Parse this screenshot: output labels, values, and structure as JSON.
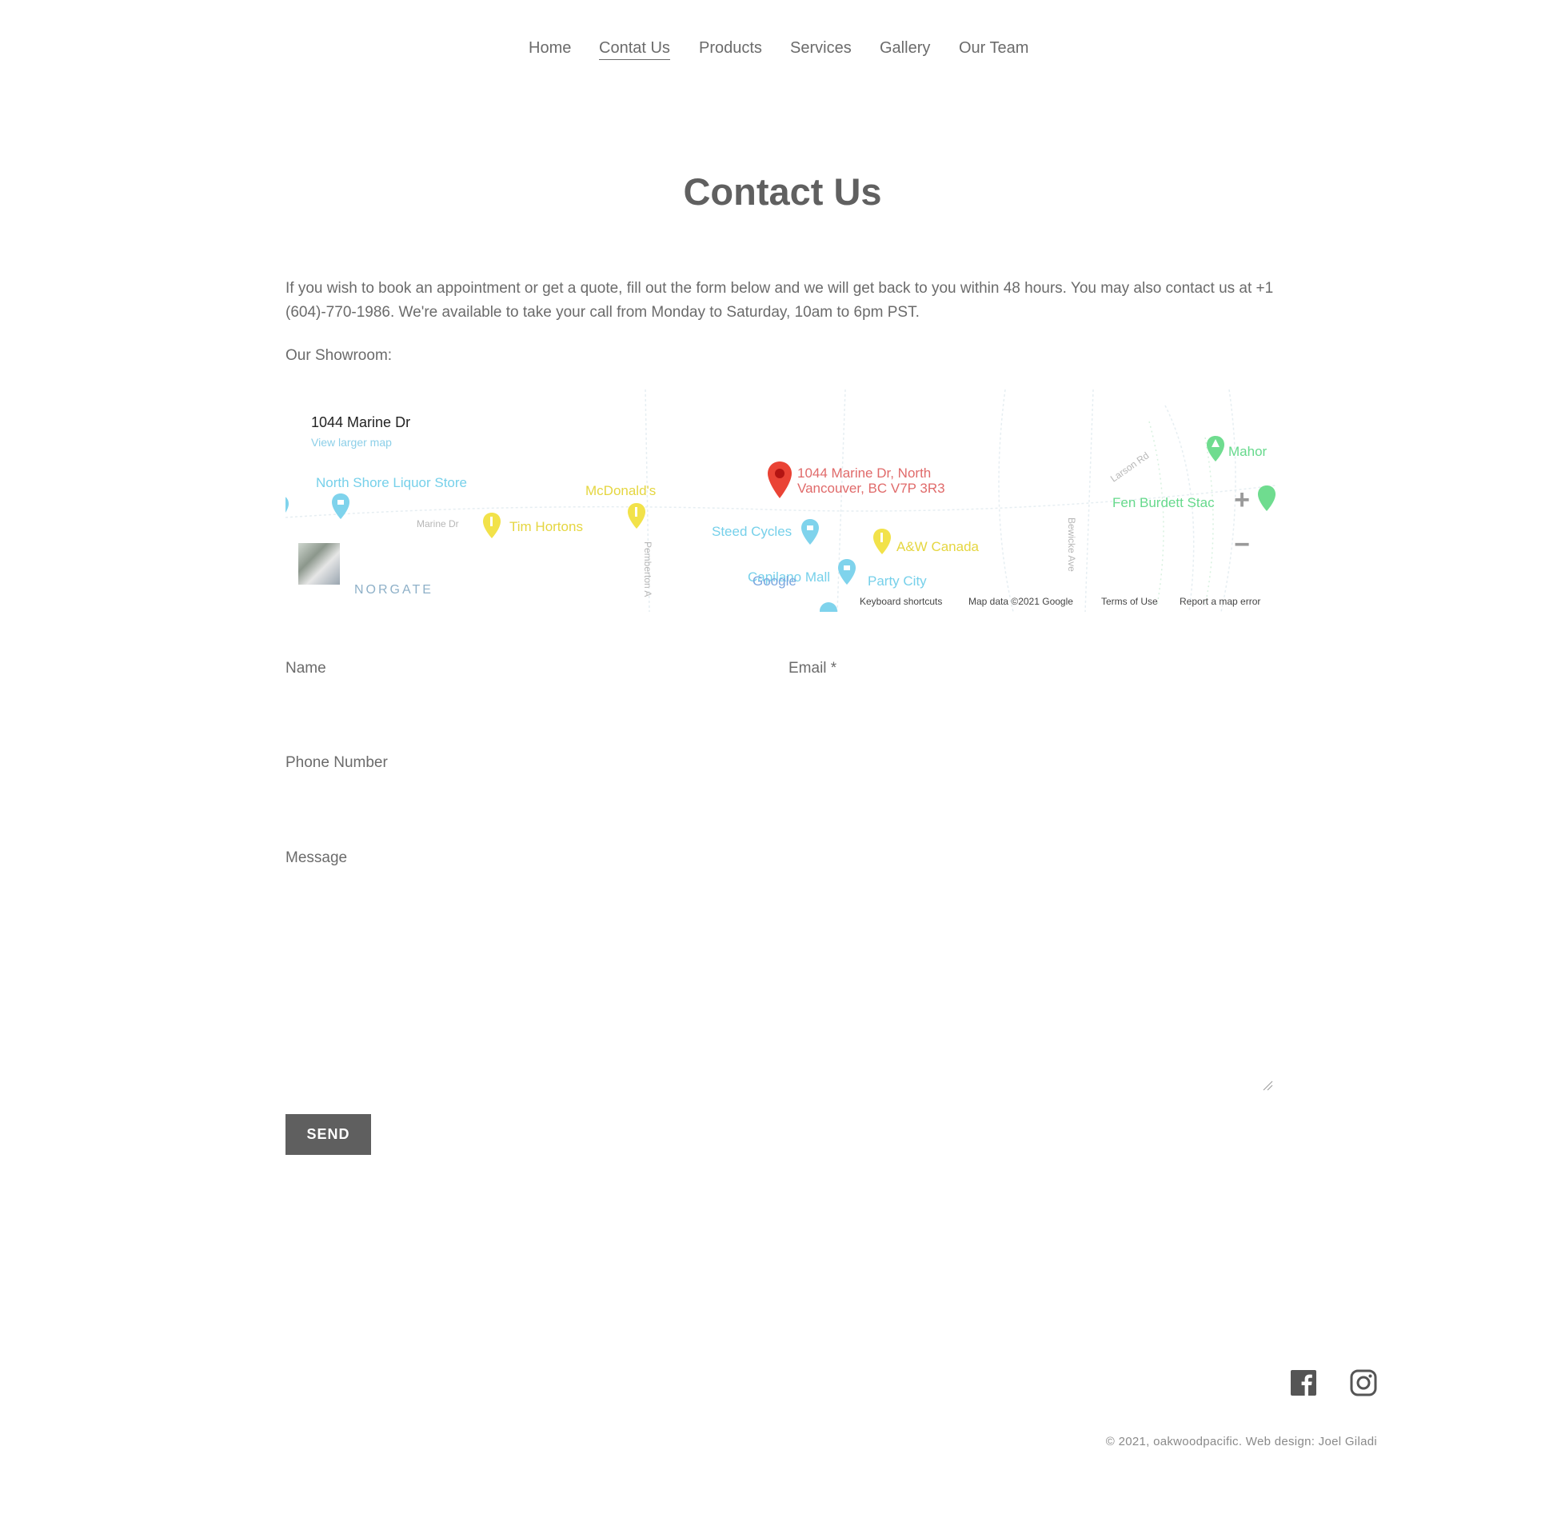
{
  "nav": {
    "items": [
      {
        "label": "Home"
      },
      {
        "label": "Contat Us",
        "active": true
      },
      {
        "label": "Products"
      },
      {
        "label": "Services"
      },
      {
        "label": "Gallery"
      },
      {
        "label": "Our Team"
      }
    ]
  },
  "page": {
    "title": "Contact Us",
    "intro": "If you wish to book an appointment or get a quote, fill out the form below and we will get back to you within 48 hours. You may also contact us at +1 (604)-770-1986. We're available to take your call from Monday to Saturday, 10am to 6pm PST.",
    "showroom_label": "Our Showroom:"
  },
  "map": {
    "card_title": "1044 Marine Dr",
    "card_link": "View larger map",
    "address_line1": "1044 Marine Dr, North",
    "address_line2": "Vancouver, BC V7P 3R3",
    "pois": {
      "liquor": "North Shore Liquor Store",
      "mcdonalds": "McDonald's",
      "tim": "Tim Hortons",
      "steed": "Steed Cycles",
      "aw": "A&W Canada",
      "capilano": "Capilano Mall",
      "party": "Party City",
      "mahon": "Mahor",
      "fen": "Fen Burdett Stac"
    },
    "streets": {
      "marine": "Marine Dr",
      "pemberton": "Pemberton A",
      "larson": "Larson Rd",
      "bewicke": "Bewicke Ave"
    },
    "district": "NORGATE",
    "google": "Google",
    "zoom_in": "+",
    "zoom_out": "−",
    "footer": {
      "shortcuts": "Keyboard shortcuts",
      "data": "Map data ©2021 Google",
      "terms": "Terms of Use",
      "report": "Report a map error"
    },
    "colors": {
      "pin_red": "#ea4335",
      "pin_blue": "#7fd3ec",
      "pin_yellow": "#f2e24a",
      "pin_green": "#6fdc8f"
    }
  },
  "form": {
    "name_label": "Name",
    "email_label": "Email *",
    "phone_label": "Phone Number",
    "message_label": "Message",
    "send_label": "SEND"
  },
  "footer": {
    "copyright": "© 2021, oakwoodpacific. Web design: Joel Giladi",
    "social": [
      "facebook-icon",
      "instagram-icon"
    ]
  }
}
